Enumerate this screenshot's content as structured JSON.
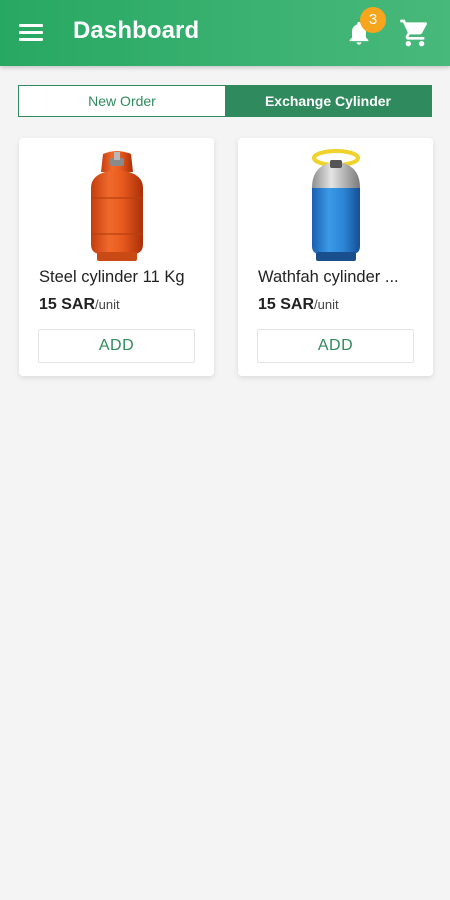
{
  "header": {
    "title": "Dashboard",
    "menu_icon": "hamburger-menu-icon",
    "notification_icon": "bell-icon",
    "notification_count": "3",
    "cart_icon": "cart-icon"
  },
  "tabs": [
    {
      "label": "New Order",
      "active": false
    },
    {
      "label": "Exchange Cylinder",
      "active": true
    }
  ],
  "products": [
    {
      "name": "Steel cylinder 11 Kg",
      "price": "15 SAR",
      "unit": "/unit",
      "button": "ADD",
      "image_icon": "orange-gas-cylinder-image"
    },
    {
      "name": "Wathfah cylinder ...",
      "price": "15 SAR",
      "unit": "/unit",
      "button": "ADD",
      "image_icon": "blue-gas-cylinder-image"
    }
  ],
  "colors": {
    "header_green": "#3cb272",
    "accent_green": "#2f8b5d",
    "badge_orange": "#f7a51c",
    "background": "#f4f4f4"
  }
}
